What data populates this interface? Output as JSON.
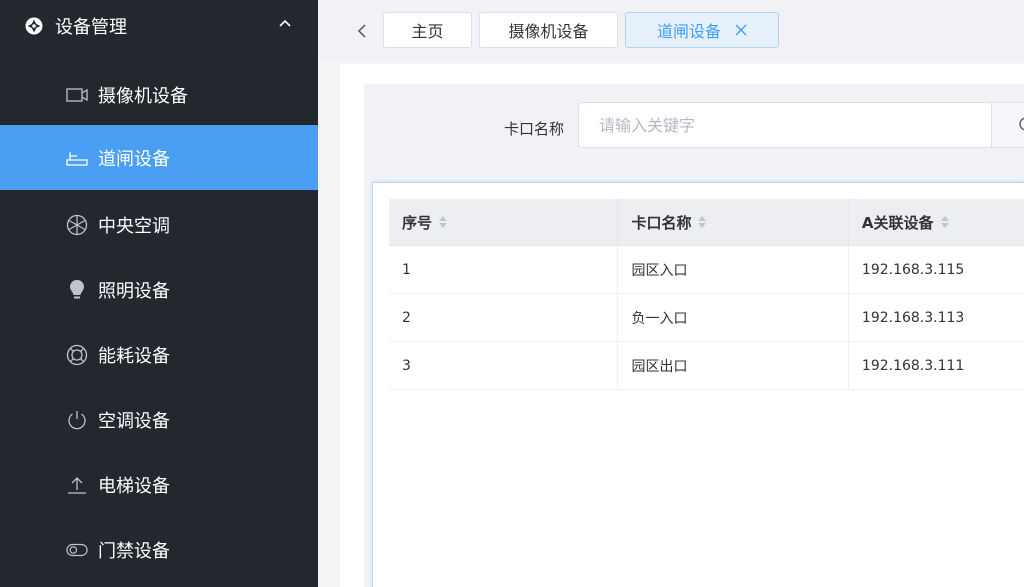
{
  "sidebar": {
    "header": {
      "title": "设备管理"
    },
    "items": [
      {
        "label": "摄像机设备",
        "icon": "camera-icon"
      },
      {
        "label": "道闸设备",
        "icon": "barrier-gate-icon",
        "active": true
      },
      {
        "label": "中央空调",
        "icon": "fan-icon"
      },
      {
        "label": "照明设备",
        "icon": "bulb-icon"
      },
      {
        "label": "能耗设备",
        "icon": "lifebuoy-icon"
      },
      {
        "label": "空调设备",
        "icon": "power-icon"
      },
      {
        "label": "电梯设备",
        "icon": "upload-icon"
      },
      {
        "label": "门禁设备",
        "icon": "toggle-icon"
      }
    ]
  },
  "tabs": [
    {
      "label": "主页"
    },
    {
      "label": "摄像机设备"
    },
    {
      "label": "道闸设备",
      "active": true,
      "closable": true
    }
  ],
  "search": {
    "label": "卡口名称",
    "placeholder": "请输入关键字"
  },
  "table": {
    "columns": [
      "序号",
      "卡口名称",
      "A关联设备"
    ],
    "rows": [
      [
        "1",
        "园区入口",
        "192.168.3.115"
      ],
      [
        "2",
        "负一入口",
        "192.168.3.113"
      ],
      [
        "3",
        "园区出口",
        "192.168.3.111"
      ]
    ]
  },
  "colors": {
    "sidebar_bg": "#23272e",
    "active_item": "#4a9ff5",
    "tab_active_text": "#409eff"
  }
}
